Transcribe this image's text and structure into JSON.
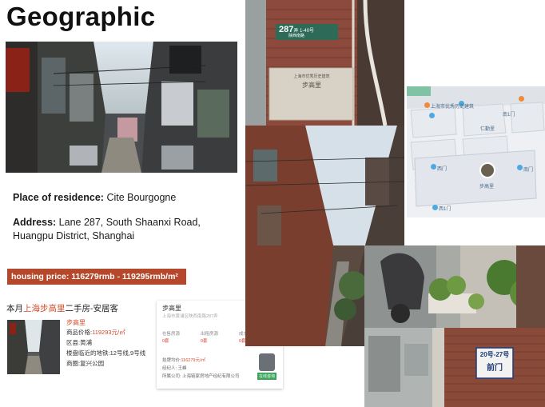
{
  "title": "Geographic",
  "residence": {
    "label": "Place of residence:",
    "value": "Cite Bourgogne"
  },
  "address": {
    "label": "Address:",
    "value": "Lane 287, South Shaanxi Road, Huangpu District, Shanghai"
  },
  "housing_price": "housing price: 116279rmb - 119295rmb/m²",
  "listing": {
    "header_prefix": "本月",
    "header_highlight": "上海步高里",
    "header_suffix": "二手房-安居客",
    "name": "步高里",
    "price_label": "商品价格:",
    "price_value": "119293元/㎡",
    "district_label": "区县:",
    "district_value": "黄浦",
    "metro_label": "楼盘临近的地铁:",
    "metro_value": "12号线,9号线",
    "park_label": "商圈:",
    "park_value": "复兴公园"
  },
  "panel": {
    "name": "步高里",
    "subtitle": "上海市黄浦区陕西南路287弄",
    "share": "分享",
    "stats": [
      {
        "label": "在售房源",
        "value": "0套"
      },
      {
        "label": "出租房源",
        "value": "0套"
      },
      {
        "label": "成交记录",
        "value": "0套"
      }
    ],
    "price_line_label": "挂牌均价:",
    "price_line_value": "116279元/㎡",
    "agent_line": "经纪人: 王峰",
    "company_line": "所属公司: 上海链家房地产经纪有限公司",
    "badge": "在线咨询"
  },
  "signs": {
    "top_sign_number": "287",
    "top_sign_text": "弄 1-40号",
    "top_sign_sub": "陕西南路",
    "plaque_title": "上海市优秀历史建筑",
    "plaque_name": "步高里",
    "gate_sign_line1": "20号-27号",
    "gate_sign_line2": "前门"
  },
  "map": {
    "labels": [
      "上海市优秀历史建筑",
      "西门",
      "步高里",
      "南门",
      "西1门",
      "南1门",
      "仁勤里"
    ]
  }
}
